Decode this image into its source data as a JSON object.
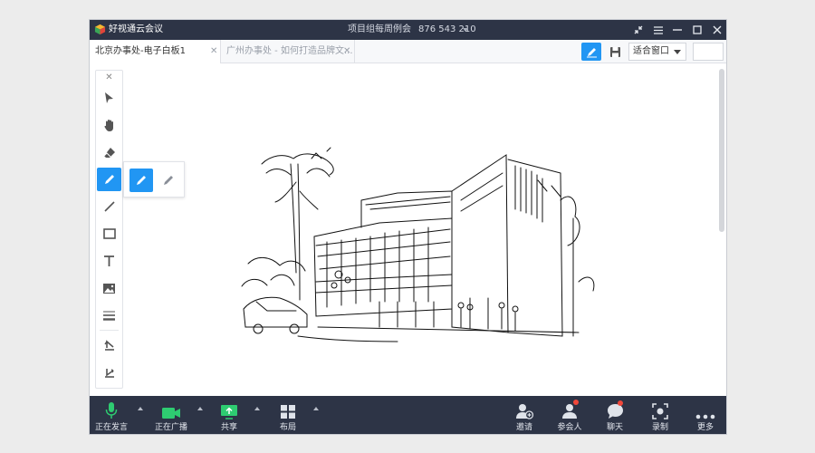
{
  "window": {
    "app_name": "好视通云会议",
    "meeting_name": "项目组每周例会",
    "meeting_id": "876 543 210"
  },
  "tabs": [
    {
      "label": "北京办事处-电子白板1",
      "active": true
    },
    {
      "label": "广州办事处 - 如何打造品牌文...",
      "active": false
    }
  ],
  "view_toolbar": {
    "fit_option": "适合窗口"
  },
  "left_tools": [
    {
      "name": "select-tool",
      "icon": "cursor-arrow-icon"
    },
    {
      "name": "pan-tool",
      "icon": "hand-icon"
    },
    {
      "name": "eraser-tool",
      "icon": "eraser-icon"
    },
    {
      "name": "pen-tool",
      "icon": "pencil-icon",
      "selected": true
    },
    {
      "name": "line-tool",
      "icon": "line-icon"
    },
    {
      "name": "rectangle-tool",
      "icon": "rectangle-icon"
    },
    {
      "name": "text-tool",
      "icon": "text-icon"
    },
    {
      "name": "image-tool",
      "icon": "image-icon"
    },
    {
      "name": "line-width-tool",
      "icon": "line-weight-icon"
    },
    {
      "name": "undo-tool",
      "icon": "undo-icon"
    },
    {
      "name": "redo-tool",
      "icon": "redo-icon"
    }
  ],
  "bottom_controls": {
    "mic": "正在发言",
    "video": "正在广播",
    "share": "共享",
    "layout": "布局",
    "invite": "邀请",
    "participants": "参会人",
    "chat": "聊天",
    "record": "录制",
    "more": "更多"
  },
  "colors": {
    "titlebar_bg": "#2d3446",
    "accent_blue": "#2196f3",
    "active_green": "#2ecc71",
    "notify_red": "#f0473a"
  }
}
